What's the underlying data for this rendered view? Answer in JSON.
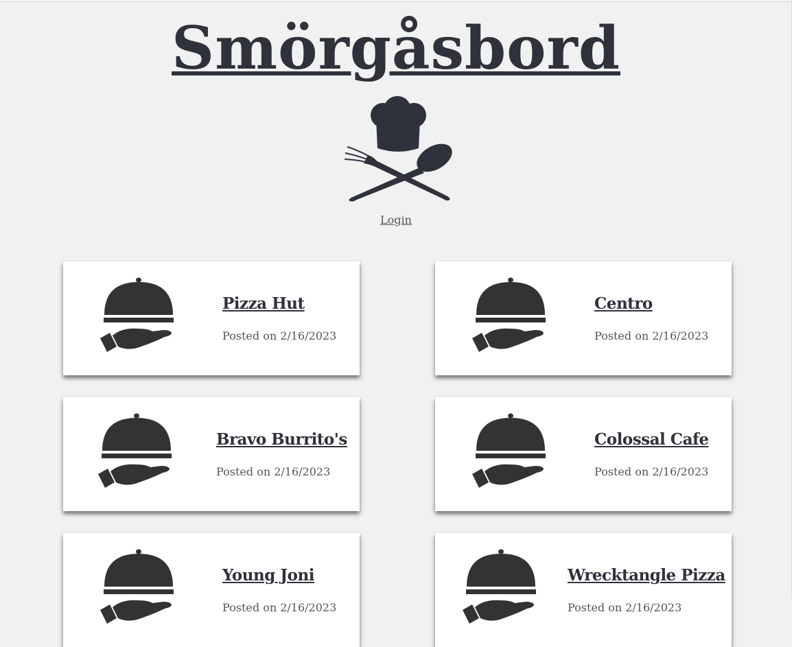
{
  "site": {
    "title": "Smörgåsbord",
    "login_label": "Login"
  },
  "icons": {
    "logo": "chef-hat-fork-spoon-icon",
    "card_icon": "serving-cloche-hand-icon"
  },
  "colors": {
    "background": "#f0f1f1",
    "text": "#2f323a",
    "card": "#ffffff"
  },
  "posted_prefix": "Posted on",
  "restaurants": [
    {
      "name": "Pizza Hut",
      "posted": "Posted on 2/16/2023"
    },
    {
      "name": "Centro",
      "posted": "Posted on 2/16/2023"
    },
    {
      "name": "Bravo Burrito's",
      "posted": "Posted on 2/16/2023"
    },
    {
      "name": "Colossal Cafe",
      "posted": "Posted on 2/16/2023"
    },
    {
      "name": "Young Joni",
      "posted": "Posted on 2/16/2023"
    },
    {
      "name": "Wrecktangle Pizza",
      "posted": "Posted on 2/16/2023"
    }
  ]
}
